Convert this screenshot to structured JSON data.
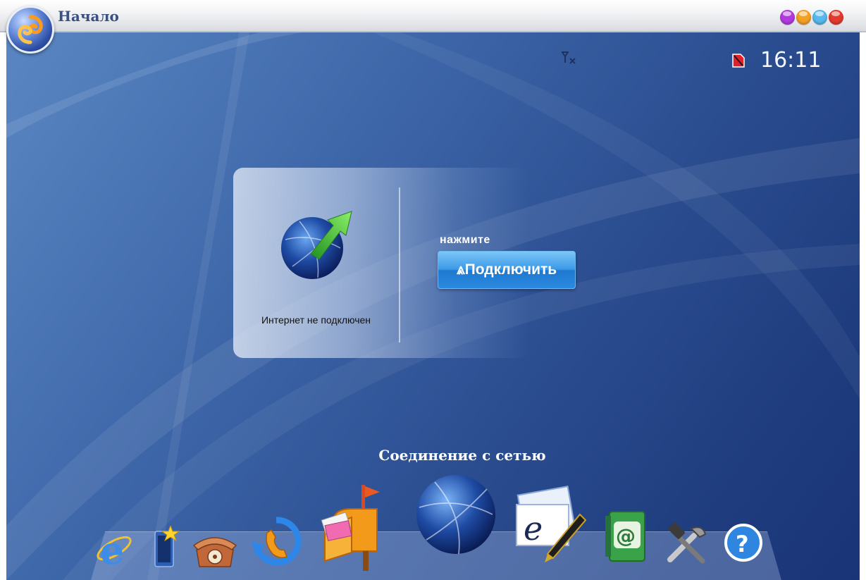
{
  "window": {
    "title": "Начало",
    "buttons": [
      "minimize",
      "restore",
      "maximize",
      "close"
    ],
    "button_colors": [
      "#b23be0",
      "#f3a126",
      "#56b8ee",
      "#e33a2e"
    ]
  },
  "status_bar": {
    "signal_icon": "no-signal-icon",
    "sim_icon": "no-sim-icon",
    "time": "16:11"
  },
  "connection_panel": {
    "status": "Интернет не подключен",
    "hint": "нажмите",
    "connect_label": "⩓Подключить"
  },
  "dock": {
    "caption": "Соединение с сетью",
    "items": [
      {
        "name": "internet-explorer-icon"
      },
      {
        "name": "favorites-icon"
      },
      {
        "name": "telephone-icon"
      },
      {
        "name": "call-sync-icon"
      },
      {
        "name": "mailbox-icon"
      },
      {
        "name": "network-globe-icon",
        "selected": true
      },
      {
        "name": "sms-write-icon"
      },
      {
        "name": "address-book-icon"
      },
      {
        "name": "tools-icon"
      },
      {
        "name": "help-icon"
      }
    ]
  },
  "colors": {
    "desktop": "#2c4f92",
    "accent_button": "#3b9ae6",
    "title_text": "#3a4f82"
  }
}
